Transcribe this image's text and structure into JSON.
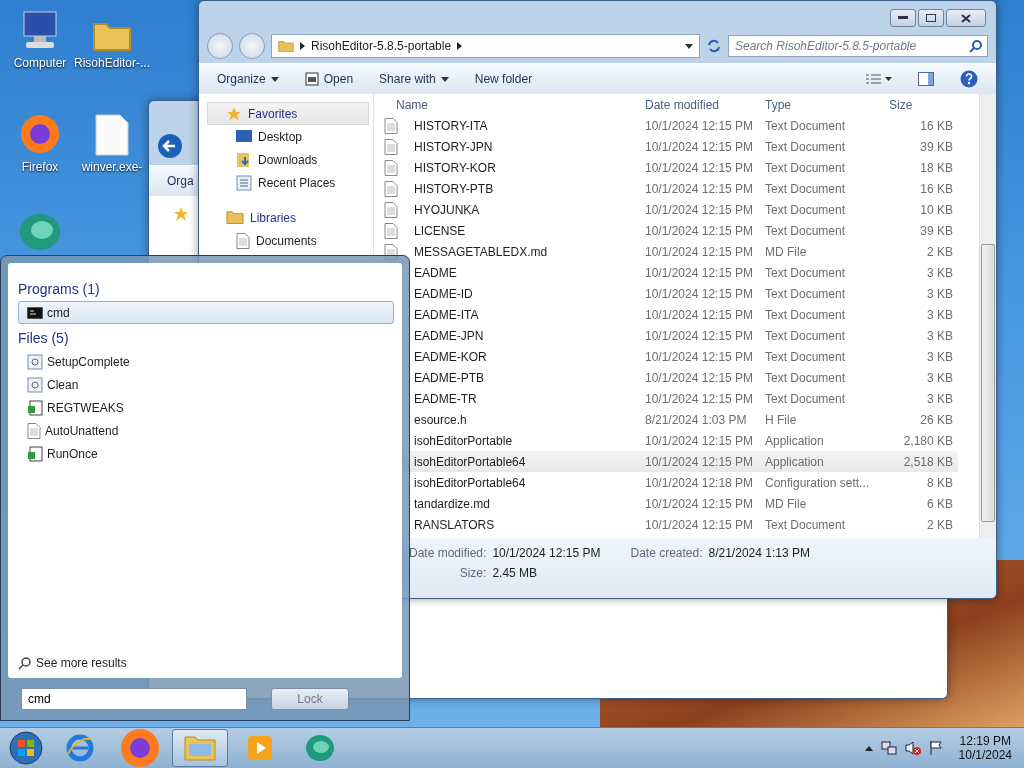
{
  "desktop_icons": [
    {
      "label": "Computer",
      "kind": "computer"
    },
    {
      "label": "RisohEditor-...",
      "kind": "folder"
    },
    {
      "label": "Firefox",
      "kind": "firefox"
    },
    {
      "label": "winver.exe-",
      "kind": "file"
    },
    {
      "kind": "app"
    }
  ],
  "background_window": {
    "toolbar_text": "Orga"
  },
  "explorer": {
    "address": "RisohEditor-5.8.5-portable",
    "search": {
      "placeholder": "Search RisohEditor-5.8.5-portable"
    },
    "toolbar": [
      {
        "label": "Organize",
        "kind": "menu"
      },
      {
        "label": "Open",
        "kind": "open"
      },
      {
        "label": "Share with",
        "kind": "menu"
      },
      {
        "label": "New folder",
        "kind": "plain"
      }
    ],
    "nav": [
      {
        "label": "Favorites",
        "kind": "favorites",
        "selected": true,
        "children": [
          {
            "label": "Desktop",
            "kind": "desktop",
            "selected": false
          },
          {
            "label": "Downloads",
            "kind": "downloads",
            "selected": false
          },
          {
            "label": "Recent Places",
            "kind": "recent",
            "selected": false
          }
        ]
      },
      {
        "label": "Libraries",
        "kind": "libraries",
        "selected": false,
        "children": [
          {
            "label": "Documents",
            "kind": "documents",
            "selected": false
          }
        ]
      }
    ],
    "columns": [
      "Name",
      "Date modified",
      "Type",
      "Size"
    ],
    "rows": [
      {
        "name": "HISTORY-ITA",
        "date": "10/1/2024 12:15 PM",
        "type": "Text Document",
        "size": "16 KB",
        "selected": false
      },
      {
        "name": "HISTORY-JPN",
        "date": "10/1/2024 12:15 PM",
        "type": "Text Document",
        "size": "39 KB",
        "selected": false
      },
      {
        "name": "HISTORY-KOR",
        "date": "10/1/2024 12:15 PM",
        "type": "Text Document",
        "size": "18 KB",
        "selected": false
      },
      {
        "name": "HISTORY-PTB",
        "date": "10/1/2024 12:15 PM",
        "type": "Text Document",
        "size": "16 KB",
        "selected": false
      },
      {
        "name": "HYOJUNKA",
        "date": "10/1/2024 12:15 PM",
        "type": "Text Document",
        "size": "10 KB",
        "selected": false
      },
      {
        "name": "LICENSE",
        "date": "10/1/2024 12:15 PM",
        "type": "Text Document",
        "size": "39 KB",
        "selected": false
      },
      {
        "name": "MESSAGETABLEDX.md",
        "date": "10/1/2024 12:15 PM",
        "type": "MD File",
        "size": "2 KB",
        "selected": false
      },
      {
        "name": "EADME",
        "date": "10/1/2024 12:15 PM",
        "type": "Text Document",
        "size": "3 KB",
        "selected": false
      },
      {
        "name": "EADME-ID",
        "date": "10/1/2024 12:15 PM",
        "type": "Text Document",
        "size": "3 KB",
        "selected": false
      },
      {
        "name": "EADME-ITA",
        "date": "10/1/2024 12:15 PM",
        "type": "Text Document",
        "size": "3 KB",
        "selected": false
      },
      {
        "name": "EADME-JPN",
        "date": "10/1/2024 12:15 PM",
        "type": "Text Document",
        "size": "3 KB",
        "selected": false
      },
      {
        "name": "EADME-KOR",
        "date": "10/1/2024 12:15 PM",
        "type": "Text Document",
        "size": "3 KB",
        "selected": false
      },
      {
        "name": "EADME-PTB",
        "date": "10/1/2024 12:15 PM",
        "type": "Text Document",
        "size": "3 KB",
        "selected": false
      },
      {
        "name": "EADME-TR",
        "date": "10/1/2024 12:15 PM",
        "type": "Text Document",
        "size": "3 KB",
        "selected": false
      },
      {
        "name": "esource.h",
        "date": "8/21/2024 1:03 PM",
        "type": "H File",
        "size": "26 KB",
        "selected": false
      },
      {
        "name": "isohEditorPortable",
        "date": "10/1/2024 12:15 PM",
        "type": "Application",
        "size": "2,180 KB",
        "selected": false
      },
      {
        "name": "isohEditorPortable64",
        "date": "10/1/2024 12:15 PM",
        "type": "Application",
        "size": "2,518 KB",
        "selected": true
      },
      {
        "name": "isohEditorPortable64",
        "date": "10/1/2024 12:18 PM",
        "type": "Configuration sett...",
        "size": "8 KB",
        "selected": false
      },
      {
        "name": "tandardize.md",
        "date": "10/1/2024 12:15 PM",
        "type": "MD File",
        "size": "6 KB",
        "selected": false
      },
      {
        "name": "RANSLATORS",
        "date": "10/1/2024 12:15 PM",
        "type": "Text Document",
        "size": "2 KB",
        "selected": false
      }
    ],
    "details": [
      {
        "label": "Date modified:",
        "value": "10/1/2024 12:15 PM"
      },
      {
        "label": "Date created:",
        "value": "8/21/2024 1:13 PM"
      },
      {
        "label": "Size:",
        "value": "2.45 MB"
      }
    ]
  },
  "start_menu": {
    "sections": [
      {
        "title": "Programs (1)",
        "items": [
          {
            "label": "cmd",
            "kind": "console",
            "selected": true
          }
        ]
      },
      {
        "title": "Files (5)",
        "items": [
          {
            "label": "SetupComplete",
            "kind": "script",
            "selected": false
          },
          {
            "label": "Clean",
            "kind": "script",
            "selected": false
          },
          {
            "label": "REGTWEAKS",
            "kind": "registry",
            "selected": false
          },
          {
            "label": "AutoUnattend",
            "kind": "xml",
            "selected": false
          },
          {
            "label": "RunOnce",
            "kind": "registry",
            "selected": false
          }
        ]
      }
    ],
    "see_more": "See more results",
    "search": {
      "value": "cmd"
    },
    "power_button": "Lock"
  },
  "taskbar": {
    "items": [
      {
        "kind": "ie",
        "active": false
      },
      {
        "kind": "firefox",
        "active": false
      },
      {
        "kind": "explorer",
        "active": true
      },
      {
        "kind": "media",
        "active": false
      },
      {
        "kind": "app",
        "active": false
      }
    ],
    "clock": {
      "time": "12:19 PM",
      "date": "10/1/2024"
    }
  }
}
